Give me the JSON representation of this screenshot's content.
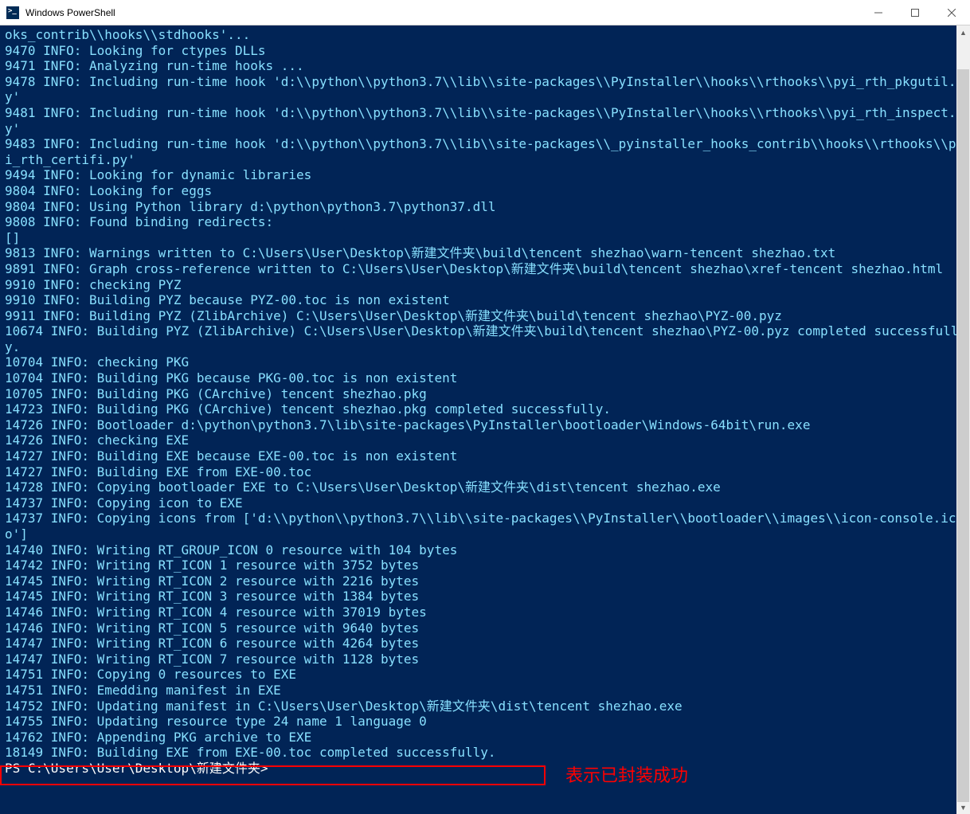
{
  "window": {
    "title": "Windows PowerShell"
  },
  "annotation": {
    "label": "表示已封装成功"
  },
  "prompt": "PS C:\\Users\\User\\Desktop\\新建文件夹>",
  "lines": [
    {
      "t": "oks_contrib\\\\hooks\\\\stdhooks'...",
      "c": "cyan"
    },
    {
      "t": "9470 INFO: Looking for ctypes DLLs",
      "c": "cyan"
    },
    {
      "t": "9471 INFO: Analyzing run-time hooks ...",
      "c": "cyan"
    },
    {
      "t": "9478 INFO: Including run-time hook 'd:\\\\python\\\\python3.7\\\\lib\\\\site-packages\\\\PyInstaller\\\\hooks\\\\rthooks\\\\pyi_rth_pkgutil.py'",
      "c": "cyan"
    },
    {
      "t": "9481 INFO: Including run-time hook 'd:\\\\python\\\\python3.7\\\\lib\\\\site-packages\\\\PyInstaller\\\\hooks\\\\rthooks\\\\pyi_rth_inspect.py'",
      "c": "cyan"
    },
    {
      "t": "9483 INFO: Including run-time hook 'd:\\\\python\\\\python3.7\\\\lib\\\\site-packages\\\\_pyinstaller_hooks_contrib\\\\hooks\\\\rthooks\\\\pyi_rth_certifi.py'",
      "c": "cyan"
    },
    {
      "t": "9494 INFO: Looking for dynamic libraries",
      "c": "cyan"
    },
    {
      "t": "9804 INFO: Looking for eggs",
      "c": "cyan"
    },
    {
      "t": "9804 INFO: Using Python library d:\\python\\python3.7\\python37.dll",
      "c": "cyan"
    },
    {
      "t": "9808 INFO: Found binding redirects:",
      "c": "cyan"
    },
    {
      "t": "[]",
      "c": "cyan"
    },
    {
      "t": "9813 INFO: Warnings written to C:\\Users\\User\\Desktop\\新建文件夹\\build\\tencent shezhao\\warn-tencent shezhao.txt",
      "c": "cyan"
    },
    {
      "t": "9891 INFO: Graph cross-reference written to C:\\Users\\User\\Desktop\\新建文件夹\\build\\tencent shezhao\\xref-tencent shezhao.html",
      "c": "cyan"
    },
    {
      "t": "9910 INFO: checking PYZ",
      "c": "cyan"
    },
    {
      "t": "9910 INFO: Building PYZ because PYZ-00.toc is non existent",
      "c": "cyan"
    },
    {
      "t": "9911 INFO: Building PYZ (ZlibArchive) C:\\Users\\User\\Desktop\\新建文件夹\\build\\tencent shezhao\\PYZ-00.pyz",
      "c": "cyan"
    },
    {
      "t": "10674 INFO: Building PYZ (ZlibArchive) C:\\Users\\User\\Desktop\\新建文件夹\\build\\tencent shezhao\\PYZ-00.pyz completed successfully.",
      "c": "cyan"
    },
    {
      "t": "10704 INFO: checking PKG",
      "c": "cyan"
    },
    {
      "t": "10704 INFO: Building PKG because PKG-00.toc is non existent",
      "c": "cyan"
    },
    {
      "t": "10705 INFO: Building PKG (CArchive) tencent shezhao.pkg",
      "c": "cyan"
    },
    {
      "t": "14723 INFO: Building PKG (CArchive) tencent shezhao.pkg completed successfully.",
      "c": "cyan"
    },
    {
      "t": "14726 INFO: Bootloader d:\\python\\python3.7\\lib\\site-packages\\PyInstaller\\bootloader\\Windows-64bit\\run.exe",
      "c": "cyan"
    },
    {
      "t": "14726 INFO: checking EXE",
      "c": "cyan"
    },
    {
      "t": "14727 INFO: Building EXE because EXE-00.toc is non existent",
      "c": "cyan"
    },
    {
      "t": "14727 INFO: Building EXE from EXE-00.toc",
      "c": "cyan"
    },
    {
      "t": "14728 INFO: Copying bootloader EXE to C:\\Users\\User\\Desktop\\新建文件夹\\dist\\tencent shezhao.exe",
      "c": "cyan"
    },
    {
      "t": "14737 INFO: Copying icon to EXE",
      "c": "cyan"
    },
    {
      "t": "14737 INFO: Copying icons from ['d:\\\\python\\\\python3.7\\\\lib\\\\site-packages\\\\PyInstaller\\\\bootloader\\\\images\\\\icon-console.ico']",
      "c": "cyan"
    },
    {
      "t": "14740 INFO: Writing RT_GROUP_ICON 0 resource with 104 bytes",
      "c": "cyan"
    },
    {
      "t": "14742 INFO: Writing RT_ICON 1 resource with 3752 bytes",
      "c": "cyan"
    },
    {
      "t": "14745 INFO: Writing RT_ICON 2 resource with 2216 bytes",
      "c": "cyan"
    },
    {
      "t": "14745 INFO: Writing RT_ICON 3 resource with 1384 bytes",
      "c": "cyan"
    },
    {
      "t": "14746 INFO: Writing RT_ICON 4 resource with 37019 bytes",
      "c": "cyan"
    },
    {
      "t": "14746 INFO: Writing RT_ICON 5 resource with 9640 bytes",
      "c": "cyan"
    },
    {
      "t": "14747 INFO: Writing RT_ICON 6 resource with 4264 bytes",
      "c": "cyan"
    },
    {
      "t": "14747 INFO: Writing RT_ICON 7 resource with 1128 bytes",
      "c": "cyan"
    },
    {
      "t": "14751 INFO: Copying 0 resources to EXE",
      "c": "cyan"
    },
    {
      "t": "14751 INFO: Emedding manifest in EXE",
      "c": "cyan"
    },
    {
      "t": "14752 INFO: Updating manifest in C:\\Users\\User\\Desktop\\新建文件夹\\dist\\tencent shezhao.exe",
      "c": "cyan"
    },
    {
      "t": "14755 INFO: Updating resource type 24 name 1 language 0",
      "c": "cyan"
    },
    {
      "t": "14762 INFO: Appending PKG archive to EXE",
      "c": "cyan"
    },
    {
      "t": "18149 INFO: Building EXE from EXE-00.toc completed successfully.",
      "c": "cyan"
    }
  ]
}
